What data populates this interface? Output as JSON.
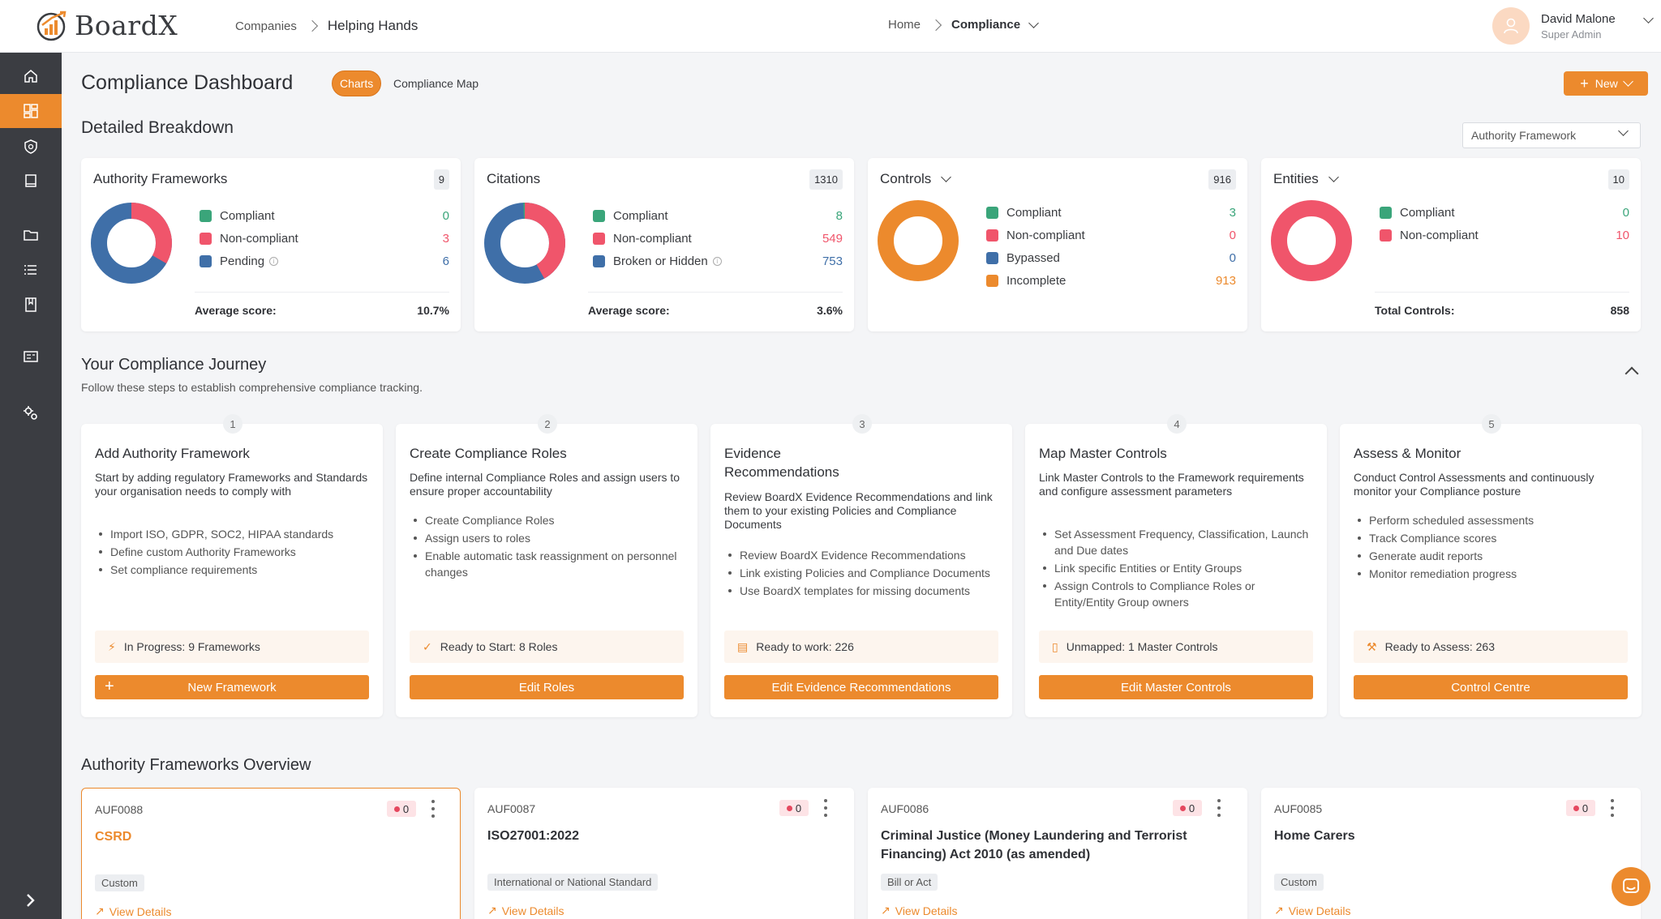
{
  "brand": {
    "name": "BoardX",
    "accent": "#ec8a2d"
  },
  "header": {
    "left_breadcrumb": [
      "Companies",
      "Helping Hands"
    ],
    "center_breadcrumb": [
      "Home",
      "Compliance"
    ],
    "user": {
      "name": "David Malone",
      "role": "Super Admin"
    }
  },
  "sidebar": {
    "items": [
      {
        "icon": "home-icon"
      },
      {
        "icon": "dashboard-icon",
        "active": true
      },
      {
        "icon": "shield-icon"
      },
      {
        "icon": "book-icon"
      },
      {
        "icon": "folder-icon"
      },
      {
        "icon": "list-icon"
      },
      {
        "icon": "bookmark-icon"
      },
      {
        "icon": "id-card-icon"
      },
      {
        "icon": "settings-cogs-icon"
      }
    ]
  },
  "page": {
    "title": "Compliance Dashboard",
    "tabs": [
      "Charts",
      "Compliance Map"
    ],
    "new_button": "New"
  },
  "breakdown": {
    "title": "Detailed Breakdown",
    "filter": "Authority Framework",
    "cards": [
      {
        "title": "Authority Frameworks",
        "count": "9",
        "legend": [
          {
            "label": "Compliant",
            "value": "0",
            "color": "#3aa57a"
          },
          {
            "label": "Non-compliant",
            "value": "3",
            "color": "#f0556b"
          },
          {
            "label": "Pending",
            "value": "6",
            "color": "#3f6fa8"
          }
        ],
        "footer_label": "Average score:",
        "footer_value": "10.7%"
      },
      {
        "title": "Citations",
        "count": "1310",
        "legend": [
          {
            "label": "Compliant",
            "value": "8",
            "color": "#3aa57a"
          },
          {
            "label": "Non-compliant",
            "value": "549",
            "color": "#f0556b"
          },
          {
            "label": "Broken or Hidden",
            "value": "753",
            "color": "#3f6fa8"
          }
        ],
        "footer_label": "Average score:",
        "footer_value": "3.6%"
      },
      {
        "title": "Controls",
        "count": "916",
        "legend": [
          {
            "label": "Compliant",
            "value": "3",
            "color": "#3aa57a"
          },
          {
            "label": "Non-compliant",
            "value": "0",
            "color": "#f0556b"
          },
          {
            "label": "Bypassed",
            "value": "0",
            "color": "#3f6fa8"
          },
          {
            "label": "Incomplete",
            "value": "913",
            "color": "#ec8a2d"
          }
        ]
      },
      {
        "title": "Entities",
        "count": "10",
        "legend": [
          {
            "label": "Compliant",
            "value": "0",
            "color": "#3aa57a"
          },
          {
            "label": "Non-compliant",
            "value": "10",
            "color": "#f0556b"
          }
        ],
        "footer_label": "Total Controls:",
        "footer_value": "858"
      }
    ]
  },
  "journey": {
    "title": "Your Compliance Journey",
    "subtitle": "Follow these steps to establish comprehensive compliance tracking.",
    "steps": [
      {
        "num": "1",
        "title": "Add Authority Framework",
        "desc": "Start by adding regulatory Frameworks and Standards your organisation needs to comply with",
        "items": [
          "Import ISO, GDPR, SOC2, HIPAA standards",
          "Define custom Authority Frameworks",
          "Set compliance requirements"
        ],
        "status": "In Progress: 9 Frameworks",
        "button": "New Framework"
      },
      {
        "num": "2",
        "title": "Create Compliance Roles",
        "desc": "Define internal Compliance Roles and assign users to ensure proper accountability",
        "items": [
          "Create Compliance Roles",
          "Assign users to roles",
          "Enable automatic task reassignment on personnel changes"
        ],
        "status": "Ready to Start: 8 Roles",
        "button": "Edit Roles"
      },
      {
        "num": "3",
        "title": "Evidence Recommendations",
        "desc": "Review BoardX Evidence Recommendations and link them to your existing Policies and Compliance Documents",
        "items": [
          "Review BoardX Evidence Recommendations",
          "Link existing Policies and Compliance Documents",
          "Use BoardX templates for missing documents"
        ],
        "status": "Ready to work: 226",
        "button": "Edit Evidence Recommendations"
      },
      {
        "num": "4",
        "title": "Map Master Controls",
        "desc": "Link Master Controls to the Framework requirements and configure assessment parameters",
        "items": [
          "Set Assessment Frequency, Classification, Launch and Due dates",
          "Link specific Entities or Entity Groups",
          "Assign Controls to Compliance Roles or Entity/Entity Group owners"
        ],
        "status": "Unmapped: 1 Master Controls",
        "button": "Edit Master Controls"
      },
      {
        "num": "5",
        "title": "Assess & Monitor",
        "desc": "Conduct Control Assessments and continuously monitor your Compliance posture",
        "items": [
          "Perform scheduled assessments",
          "Track Compliance scores",
          "Generate audit reports",
          "Monitor remediation progress"
        ],
        "status": "Ready to Assess: 263",
        "button": "Control Centre"
      }
    ]
  },
  "frameworks": {
    "title": "Authority Frameworks Overview",
    "link_label": "View Details",
    "items": [
      {
        "id": "AUF0088",
        "badge": "0",
        "name": "CSRD",
        "tag": "Custom",
        "selected": true
      },
      {
        "id": "AUF0087",
        "badge": "0",
        "name": "ISO27001:2022",
        "tag": "International or National Standard"
      },
      {
        "id": "AUF0086",
        "badge": "0",
        "name": "Criminal Justice (Money Laundering and Terrorist Financing) Act 2010 (as amended)",
        "tag": "Bill or Act"
      },
      {
        "id": "AUF0085",
        "badge": "0",
        "name": "Home Carers",
        "tag": "Custom"
      }
    ]
  }
}
